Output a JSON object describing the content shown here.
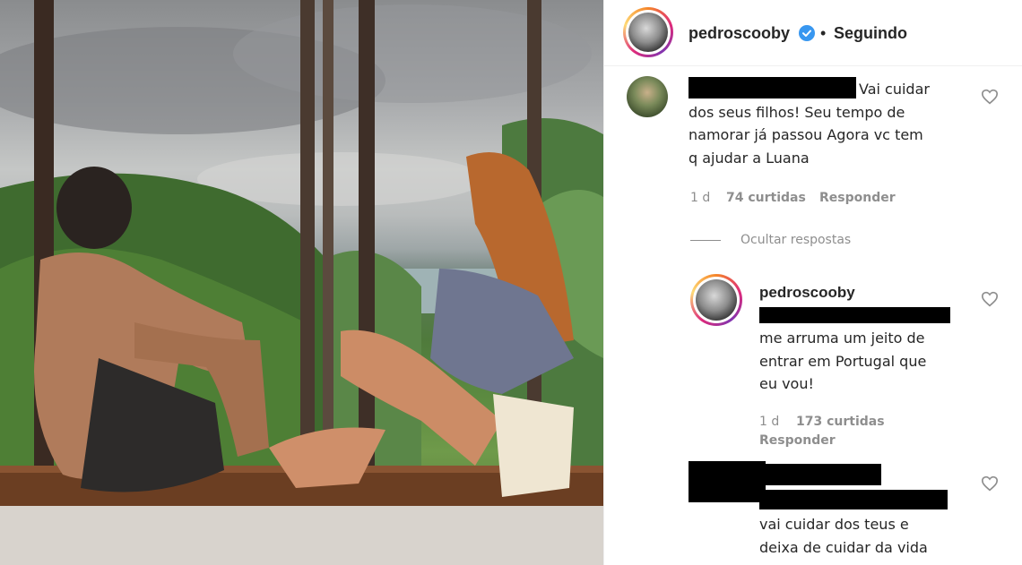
{
  "post": {
    "author": "pedroscooby",
    "verified": true,
    "separator": "•",
    "follow_status": "Seguindo"
  },
  "comments": [
    {
      "text": "Vai cuidar\ndos seus filhos! Seu tempo de\nnamorar já passou Agora vc tem\nq ajudar a Luana",
      "time": "1 d",
      "likes": "74 curtidas",
      "reply": "Responder",
      "hide_replies": "Ocultar respostas"
    }
  ],
  "reply": {
    "author": "pedroscooby",
    "text": "me arruma um jeito de\nentrar em Portugal que\neu vou!",
    "time": "1 d",
    "likes": "173 curtidas",
    "reply": "Responder"
  },
  "comment2": {
    "text": "vai cuidar dos teus e\ndeixa de cuidar da vida"
  },
  "colors": {
    "text": "#262626",
    "muted": "#8e8e8e",
    "verified": "#3897f0",
    "divider": "#efefef"
  },
  "icons": [
    "verified-badge-icon",
    "heart-icon"
  ]
}
